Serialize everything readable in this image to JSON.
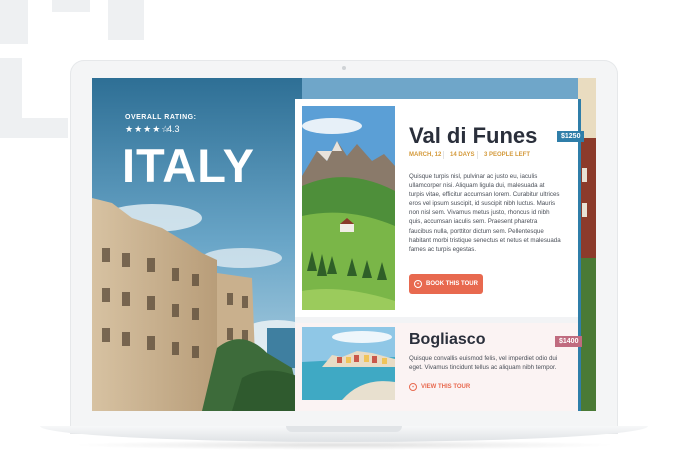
{
  "hero": {
    "rating_label": "OVERALL RATING:",
    "stars": "★★★★☆",
    "rating_value": "4.3",
    "country": "ITALY"
  },
  "tours": [
    {
      "title": "Val di Funes",
      "price": "$1250",
      "date": "MARCH, 12",
      "days": "14 DAYS",
      "people": "3 PEOPLE LEFT",
      "description": "Quisque turpis nisl, pulvinar ac justo eu, iaculis ullamcorper nisi. Aliquam ligula dui, malesuada at turpis vitae, efficitur accumsan lorem. Curabitur ultrices eros vel ipsum suscipit, id suscipit nibh luctus. Mauris non nisl sem. Vivamus metus justo, rhoncus id nibh quis, accumsan iaculis sem. Praesent pharetra faucibus nulla, porttitor dictum sem. Pellentesque habitant morbi tristique senectus et netus et malesuada fames ac turpis egestas.",
      "button_label": "BOOK THIS TOUR"
    },
    {
      "title": "Bogliasco",
      "price": "$1400",
      "description": "Quisque convallis euismod felis, vel imperdiet odio dui eget. Vivamus tincidunt tellus ac aliquam nibh tempor.",
      "link_label": "VIEW THIS TOUR"
    }
  ],
  "colors": {
    "accent_blue": "#2f7ea9",
    "button_coral": "#e8694f",
    "price_rose": "#c06b7f",
    "meta_gold": "#d49a3b"
  },
  "icons": {
    "button_icon": "plus-circle-icon",
    "link_icon": "plus-circle-icon"
  }
}
